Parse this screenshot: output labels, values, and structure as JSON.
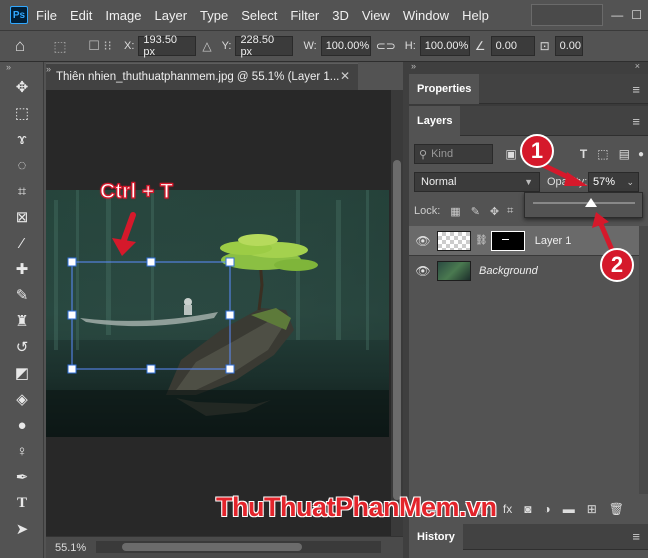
{
  "app": {
    "logo": "Ps"
  },
  "menu": [
    "File",
    "Edit",
    "Image",
    "Layer",
    "Type",
    "Select",
    "Filter",
    "3D",
    "View",
    "Window",
    "Help"
  ],
  "options": {
    "x_label": "X:",
    "x_value": "193.50 px",
    "y_label": "Y:",
    "y_value": "228.50 px",
    "w_label": "W:",
    "w_value": "100.00%",
    "h_label": "H:",
    "h_value": "100.00%",
    "angle_value": "0.00",
    "skew_value": "0.00"
  },
  "document": {
    "tab_title": "Thiên nhien_thuthuatphanmem.jpg @ 55.1% (Layer 1...",
    "zoom": "55.1%"
  },
  "panels": {
    "properties_tab": "Properties",
    "layers_tab": "Layers",
    "kind_placeholder": "Kind",
    "blend_mode": "Normal",
    "opacity_label": "Opacity:",
    "opacity_value": "57%",
    "opacity_fraction": 0.57,
    "lock_label": "Lock:",
    "history_tab": "History"
  },
  "layers": [
    {
      "name": "Layer 1",
      "selected": true
    },
    {
      "name": "Background",
      "italic": true
    }
  ],
  "annotations": {
    "hotkey": "Ctrl + T",
    "step1": "1",
    "step2": "2",
    "watermark": "ThuThuatPhanMem.vn"
  },
  "colors": {
    "app_bg": "#535353",
    "canvas_bg": "#282828",
    "annotation_red": "#d5192b",
    "selection_blue": "#2f6fd9"
  }
}
